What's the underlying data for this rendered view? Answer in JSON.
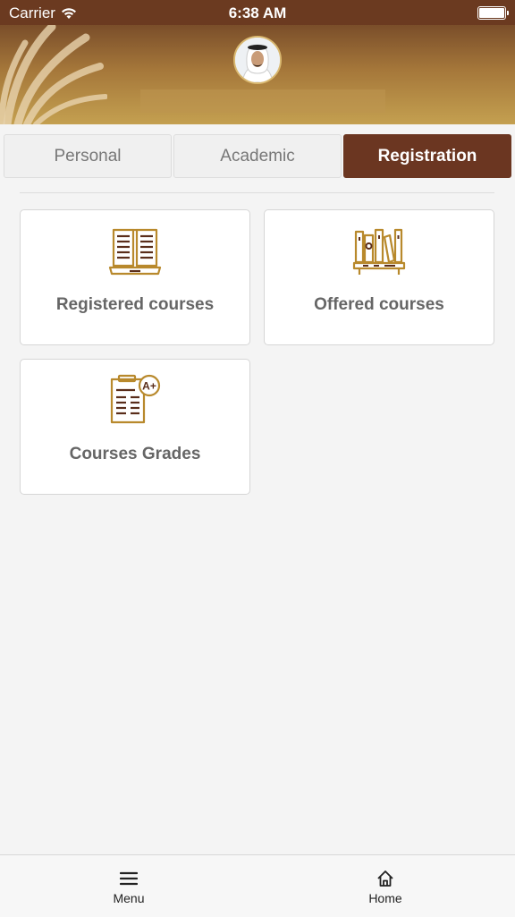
{
  "status_bar": {
    "carrier": "Carrier",
    "time": "6:38 AM"
  },
  "tabs": [
    {
      "label": "Personal",
      "active": false
    },
    {
      "label": "Academic",
      "active": false
    },
    {
      "label": "Registration",
      "active": true
    }
  ],
  "cards": [
    {
      "label": "Registered courses",
      "icon": "open-book-icon"
    },
    {
      "label": "Offered courses",
      "icon": "bookshelf-icon"
    },
    {
      "label": "Courses Grades",
      "icon": "grade-report-icon"
    }
  ],
  "bottom_nav": {
    "menu_label": "Menu",
    "home_label": "Home"
  },
  "colors": {
    "brand_brown": "#6b3621",
    "gold": "#b8892c",
    "header_gradient_top": "#7a4e2a",
    "header_gradient_bottom": "#c4a050"
  }
}
